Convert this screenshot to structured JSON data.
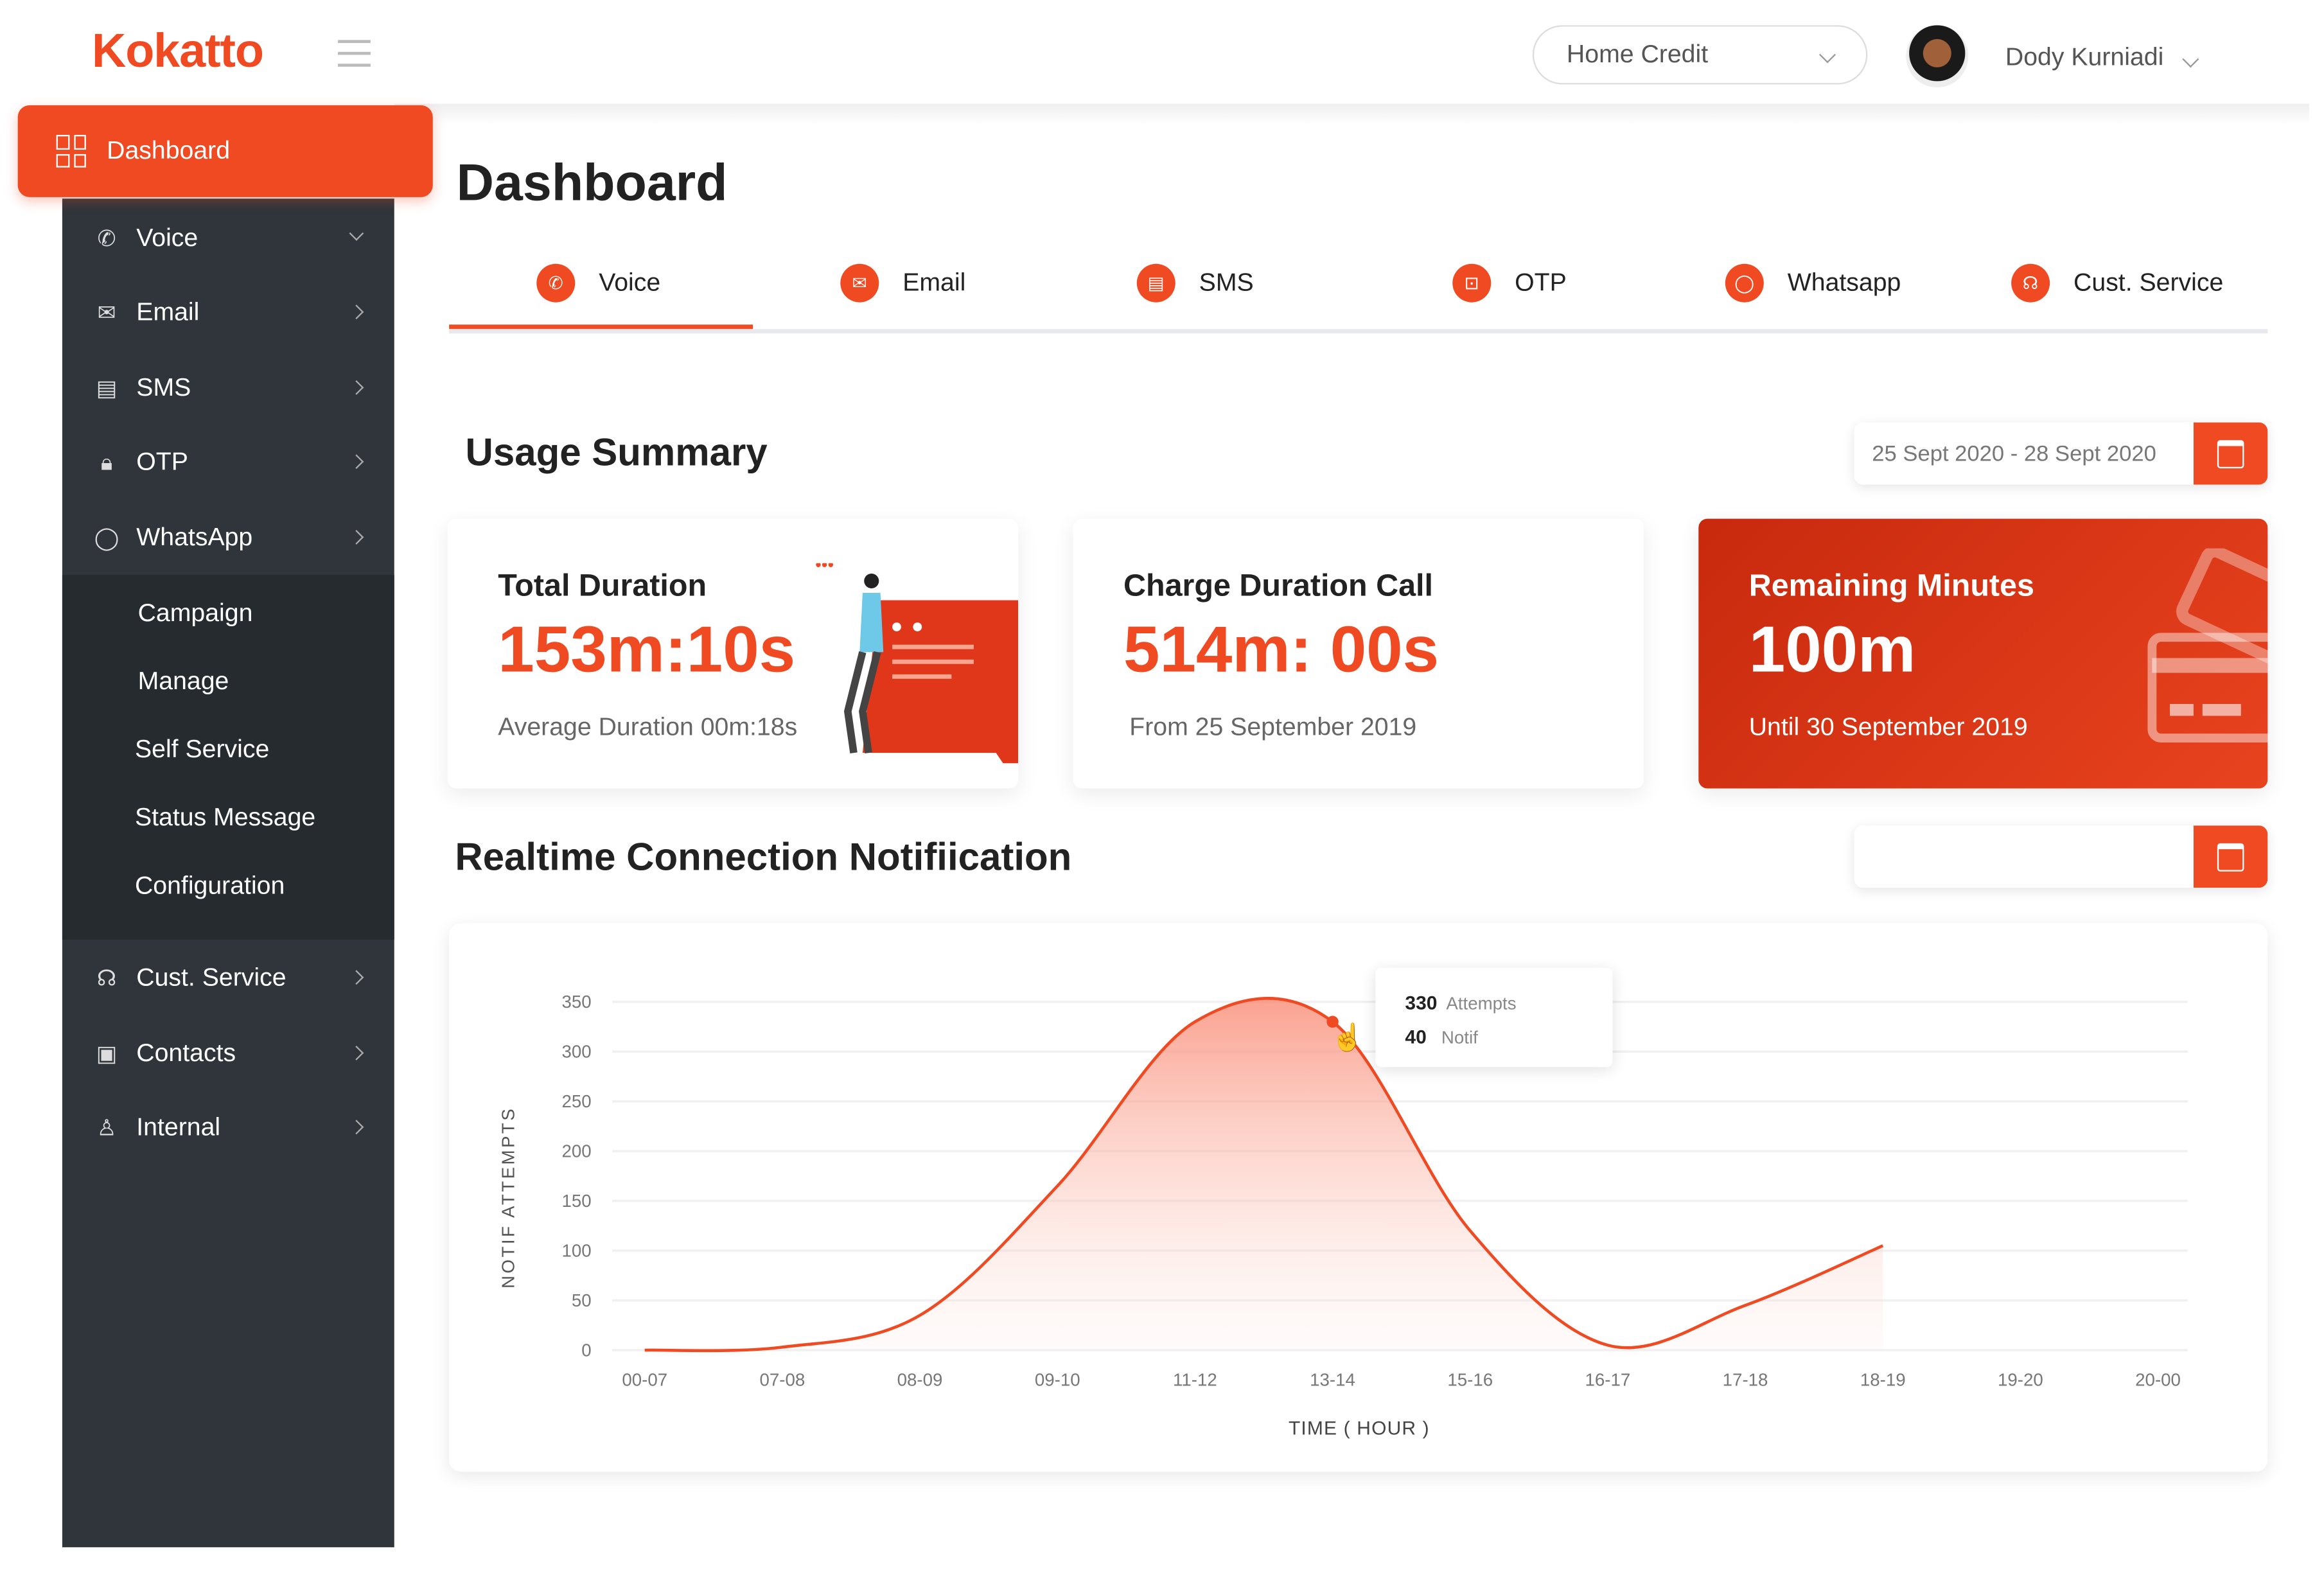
{
  "brand": {
    "logo": "Kokatto",
    "accent": "#f04a23"
  },
  "header": {
    "company_select": "Home Credit",
    "user_name": "Dody Kurniadi"
  },
  "sidebar": {
    "active": "Dashboard",
    "items": [
      {
        "label": "Voice",
        "icon": "phone-icon"
      },
      {
        "label": "Email",
        "icon": "mail-icon"
      },
      {
        "label": "SMS",
        "icon": "message-icon"
      },
      {
        "label": "OTP",
        "icon": "lock-icon"
      },
      {
        "label": "WhatsApp",
        "icon": "whatsapp-icon"
      }
    ],
    "submenu": [
      "Campaign",
      "Manage",
      "Self Service",
      "Status Message",
      "Configuration"
    ],
    "items_bottom": [
      {
        "label": "Cust. Service",
        "icon": "headset-icon"
      },
      {
        "label": "Contacts",
        "icon": "contacts-icon"
      },
      {
        "label": "Internal",
        "icon": "user-icon"
      }
    ]
  },
  "page": {
    "title": "Dashboard"
  },
  "tabs": [
    "Voice",
    "Email",
    "SMS",
    "OTP",
    "Whatsapp",
    "Cust. Service"
  ],
  "usage": {
    "title": "Usage Summary",
    "date_range": "25 Sept 2020 - 28 Sept 2020",
    "cards": [
      {
        "title": "Total Duration",
        "value": "153m:10s",
        "sub": "Average Duration 00m:18s"
      },
      {
        "title": "Charge Duration Call",
        "value": "514m: 00s",
        "sub": "From 25 September 2019"
      },
      {
        "title": "Remaining Minutes",
        "value": "100m",
        "sub": "Until 30 September 2019"
      }
    ]
  },
  "realtime": {
    "title": "Realtime Connection Notifiication",
    "date_range": ""
  },
  "chart_data": {
    "type": "area",
    "categories": [
      "00-07",
      "07-08",
      "08-09",
      "09-10",
      "11-12",
      "13-14",
      "15-16",
      "16-17",
      "17-18",
      "18-19",
      "19-20",
      "20-00"
    ],
    "values": [
      0,
      3,
      35,
      165,
      330,
      330,
      120,
      5,
      45,
      105,
      null,
      null
    ],
    "xlabel": "TIME ( HOUR )",
    "ylabel": "NOTIF ATTEMPTS",
    "ylim": [
      0,
      350
    ],
    "yticks": [
      0,
      50,
      100,
      150,
      200,
      250,
      300,
      350
    ],
    "grid": true,
    "color": "#f04a23",
    "tooltip": {
      "attempts": "330",
      "attempts_label": "Attempts",
      "notif": "40",
      "notif_label": "Notif"
    }
  }
}
